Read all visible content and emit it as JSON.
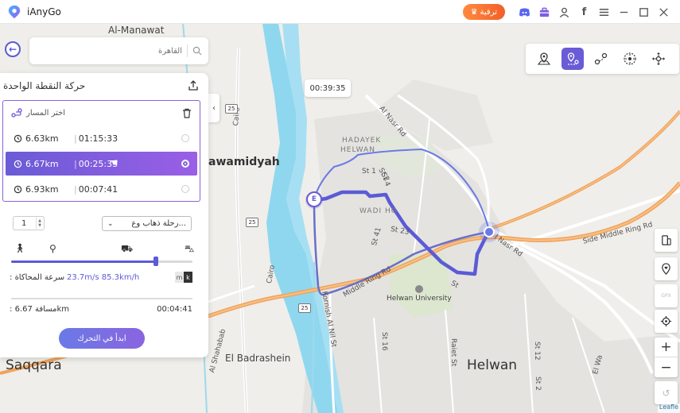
{
  "app": {
    "title": "iAnyGo"
  },
  "titlebar": {
    "upgrade_label": "ترقية"
  },
  "search": {
    "placeholder": "القاهرة"
  },
  "panel": {
    "title": "حركة النقطة الواحدة",
    "route_header": "اختر المسار",
    "routes": [
      {
        "distance": "6.63km",
        "time": "01:15:33",
        "selected": false
      },
      {
        "distance": "6.67km",
        "time": "00:25:33",
        "selected": true
      },
      {
        "distance": "6.93km",
        "time": "00:07:41",
        "selected": false
      }
    ],
    "repeat_count": "1",
    "trip_type": "رحلة ذهاب وع...",
    "speed_label": ": سرعة المحاكاة",
    "speed_value": "23.7m/s 85.3km/h",
    "unit_m": "m",
    "unit_k": "k",
    "speed_fraction": 0.8,
    "distance_label": ": مسافة 6.67km",
    "remaining_time": "00:04:41",
    "start_label": "ابدأ في التحرك"
  },
  "map": {
    "time_bubble": "00:39:35",
    "end_marker": "E",
    "labels": {
      "al_manawat": "Al-Manawat",
      "hawamidyah": "awamidyah",
      "hadayek_helwan_1": "HADAYEK",
      "hadayek_helwan_2": "HELWAN",
      "wadi_hof": "WADI HO",
      "st1": "St 1",
      "st2": "St 2",
      "st23": "St 23",
      "st41": "St 41",
      "st4": "St 4",
      "st": "St",
      "al_nasr_rd": "Al Nasr Rd",
      "nasr_rd": "l Nasr Rd",
      "side_middle_ring": "Side Middle Ring Rd",
      "middle_ring": "Middle Ring Rd",
      "cairo1": "Cairo",
      "cairo2": "Cairo",
      "kornish": "Kornish Al Nil St",
      "al_shahabab": "Al Shahabab",
      "badrashein": "El Badrashein",
      "saqqara": "Saqqara",
      "helwan": "Helwan",
      "helwan_univ": "Helwan University",
      "st16": "St 16",
      "raiet": "Raiet St",
      "st12": "St 12",
      "st2b": "St 2",
      "el_wa": "El Wa",
      "ras": "Ras",
      "shield_25a": "25",
      "shield_25b": "25",
      "shield_25c": "25",
      "gpx": "GPX"
    },
    "attribution": "Leafle"
  },
  "colors": {
    "accent": "#6a5bd6",
    "route": "#5b5bd6",
    "river": "#8fd7ef",
    "orange_road": "#f0a35c"
  },
  "icons": {
    "mode_toolbar": [
      "teleport-icon",
      "single-spot-icon",
      "multi-spot-icon",
      "joystick-icon",
      "jump-teleport-icon"
    ]
  }
}
